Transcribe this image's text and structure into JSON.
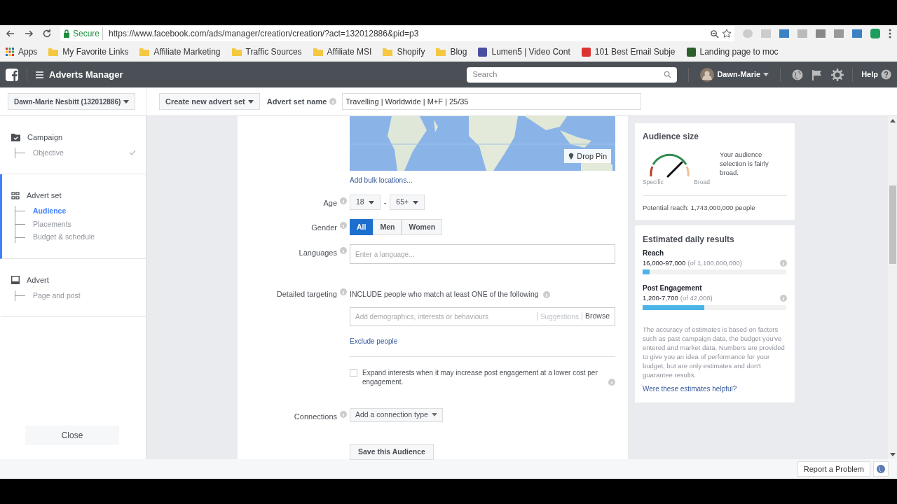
{
  "browser": {
    "secure_label": "Secure",
    "url": "https://www.facebook.com/ads/manager/creation/creation/?act=132012886&pid=p3",
    "bookmarks": [
      {
        "label": "Apps",
        "kind": "apps"
      },
      {
        "label": "My Favorite Links",
        "kind": "folder"
      },
      {
        "label": "Affiliate Marketing",
        "kind": "folder"
      },
      {
        "label": "Traffic Sources",
        "kind": "folder"
      },
      {
        "label": "Affiliate MSI",
        "kind": "folder"
      },
      {
        "label": "Shopify",
        "kind": "folder"
      },
      {
        "label": "Blog",
        "kind": "folder"
      },
      {
        "label": "Lumen5 | Video Cont",
        "kind": "site"
      },
      {
        "label": "101 Best Email Subje",
        "kind": "site"
      },
      {
        "label": "Landing page to moc",
        "kind": "site"
      }
    ]
  },
  "header": {
    "title": "Adverts Manager",
    "search_placeholder": "Search",
    "user": "Dawn-Marie",
    "help": "Help"
  },
  "subbar": {
    "account": "Dawn-Marie Nesbitt (132012886)",
    "create": "Create new advert set",
    "name_label": "Advert set name",
    "name_value": "Travelling | Worldwide | M+F | 25/35"
  },
  "sidebar": {
    "sections": [
      {
        "title": "Campaign",
        "kind": "campaign",
        "selected": false,
        "children": [
          {
            "label": "Objective",
            "selected": false,
            "done": true
          }
        ]
      },
      {
        "title": "Advert set",
        "kind": "adset",
        "selected": true,
        "children": [
          {
            "label": "Audience",
            "selected": true,
            "done": false
          },
          {
            "label": "Placements",
            "selected": false,
            "done": false
          },
          {
            "label": "Budget & schedule",
            "selected": false,
            "done": false
          }
        ]
      },
      {
        "title": "Advert",
        "kind": "advert",
        "selected": false,
        "children": [
          {
            "label": "Page and post",
            "selected": false,
            "done": false
          }
        ]
      }
    ],
    "close": "Close"
  },
  "form": {
    "map": {
      "drop_pin": "Drop Pin"
    },
    "bulk_link": "Add bulk locations...",
    "age": {
      "label": "Age",
      "from": "18",
      "separator": "-",
      "to": "65+"
    },
    "gender": {
      "label": "Gender",
      "options": [
        {
          "label": "All",
          "selected": true
        },
        {
          "label": "Men",
          "selected": false
        },
        {
          "label": "Women",
          "selected": false
        }
      ]
    },
    "languages": {
      "label": "Languages",
      "placeholder": "Enter a language..."
    },
    "detailed": {
      "label": "Detailed targeting",
      "include": "INCLUDE people who match at least ONE of the following",
      "placeholder": "Add demographics, interests or behaviours",
      "suggestions": "Suggestions",
      "browse": "Browse",
      "exclude": "Exclude people",
      "expand": "Expand interests when it may increase post engagement at a lower cost per engagement.",
      "expand_checked": false
    },
    "connections": {
      "label": "Connections",
      "button": "Add a connection type"
    },
    "save": "Save this Audience"
  },
  "audience": {
    "title": "Audience size",
    "specific": "Specific",
    "broad": "Broad",
    "description": "Your audience selection is fairly broad.",
    "reach": "Potential reach: 1,743,000,000 people"
  },
  "estimates": {
    "title": "Estimated daily results",
    "metrics": [
      {
        "name": "Reach",
        "range": "16,000-97,000",
        "total": "(of 1,100,000,000)",
        "level": 0.05
      },
      {
        "name": "Post Engagement",
        "range": "1,200-7,700",
        "total": "(of 42,000)",
        "level": 0.43
      }
    ],
    "note": "The accuracy of estimates is based on factors such as past campaign data, the budget you've entered and market data. Numbers are provided to give you an idea of performance for your budget, but are only estimates and don't guarantee results.",
    "helpful": "Were these estimates helpful?"
  },
  "footer": {
    "report": "Report a Problem"
  }
}
